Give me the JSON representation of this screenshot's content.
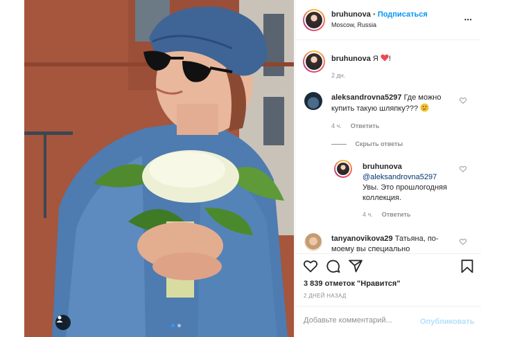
{
  "post": {
    "author": "bruhunova",
    "follow_separator": "•",
    "follow_label": "Подписаться",
    "location": "Moscow, Russia",
    "more_label": "•••"
  },
  "caption": {
    "username": "bruhunova",
    "text": "Я",
    "suffix": "!",
    "time": "2 дн."
  },
  "comments": [
    {
      "username": "aleksandrovna5297",
      "text_line1": "Где можно",
      "text_line2": "купить такую шляпку???",
      "time": "4 ч.",
      "reply_label": "Ответить"
    }
  ],
  "hide_replies_label": "Скрыть ответы",
  "reply": {
    "username": "bruhunova",
    "mention": "@aleksandrovna5297",
    "text_line1": "Увы. Это прошлогодняя",
    "text_line2": "коллекция.",
    "time": "4 ч.",
    "reply_label": "Ответить"
  },
  "comment2": {
    "username": "tanyanovikova29",
    "text_line1": "Татьяна, по-",
    "text_line2": "моему вы специально"
  },
  "likes_text": "3 839 отметок \"Нравится\"",
  "date_text": "2 ДНЕЙ НАЗАД",
  "comment_input": {
    "placeholder": "Добавьте комментарий...",
    "value": ""
  },
  "publish_label": "Опубликовать",
  "colors": {
    "accent": "#0095f6",
    "publish_disabled": "#b2dffc",
    "heart_red": "#ed4956"
  },
  "icons": {
    "heart": "heart-icon",
    "comment": "comment-icon",
    "share": "paper-plane-icon",
    "save": "bookmark-icon"
  }
}
